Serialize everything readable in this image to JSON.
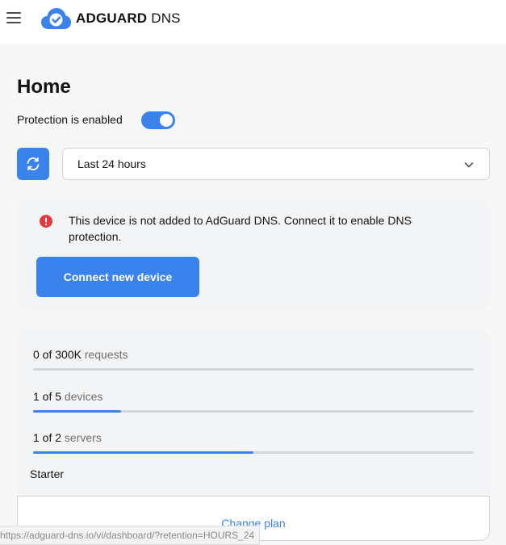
{
  "header": {
    "logo_bold": "ADGUARD",
    "logo_light": " DNS",
    "menu_icon": "hamburger-menu-icon",
    "logo_icon": "adguard-cloud-check-icon"
  },
  "page": {
    "title": "Home",
    "protection_label": "Protection is enabled",
    "protection_enabled": true
  },
  "filters": {
    "refresh_icon": "refresh-icon",
    "period_value": "Last 24 hours",
    "chevron_icon": "chevron-down-icon"
  },
  "warning": {
    "icon": "alert-circle-icon",
    "text": "This device is not added to AdGuard DNS. Connect it to enable DNS protection.",
    "button_label": "Connect new device"
  },
  "usage": {
    "requests": {
      "count": "0 of 300K",
      "unit": " requests",
      "fraction": 0.0
    },
    "devices": {
      "count": "1 of 5",
      "unit": " devices",
      "fraction": 0.2
    },
    "servers": {
      "count": "1 of 2",
      "unit": " servers",
      "fraction": 0.5
    },
    "plan_name": "Starter",
    "change_plan_label": "Change plan"
  },
  "status_bar": {
    "url": "https://adguard-dns.io/vi/dashboard/?retention=HOURS_24"
  },
  "colors": {
    "accent": "#3b83ec",
    "danger": "#e8363d",
    "card_bg": "#f3f4f6",
    "page_bg": "#f7f7f7"
  }
}
